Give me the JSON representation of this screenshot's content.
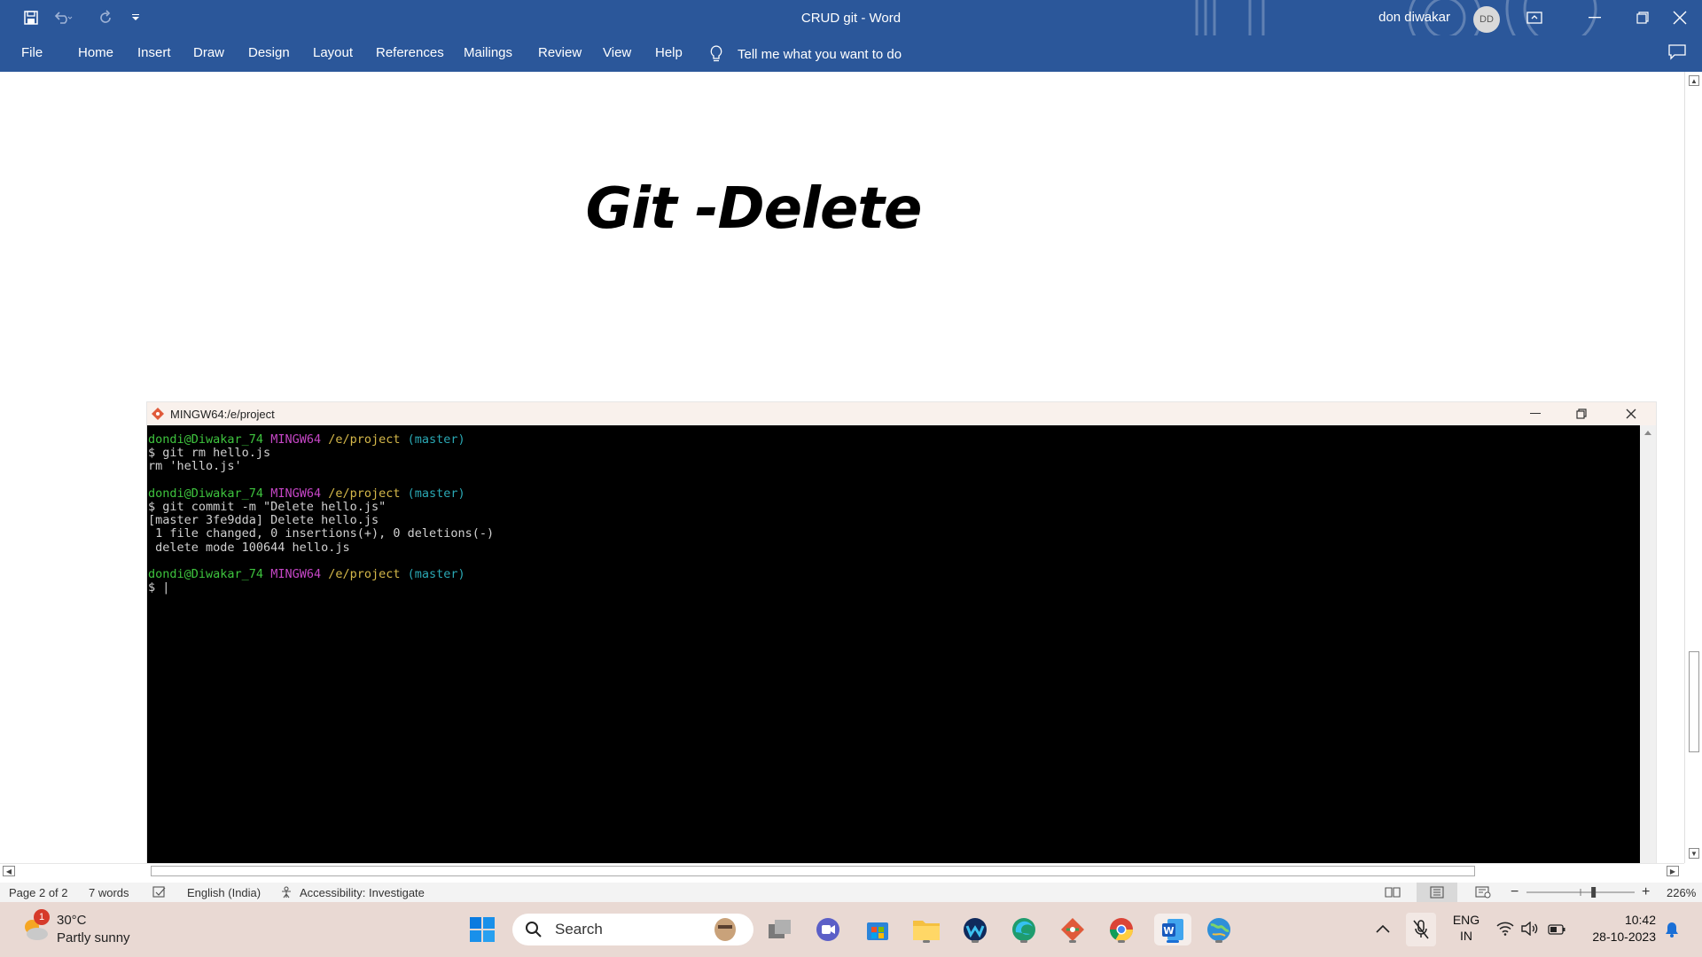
{
  "window": {
    "title": "CRUD git  -  Word",
    "user_name": "don diwakar",
    "user_initials": "DD"
  },
  "ribbon": {
    "tabs": [
      "File",
      "Home",
      "Insert",
      "Draw",
      "Design",
      "Layout",
      "References",
      "Mailings",
      "Review",
      "View",
      "Help"
    ],
    "tell_me": "Tell me what you want to do"
  },
  "document": {
    "heading": "Git -Delete"
  },
  "terminal": {
    "title": "MINGW64:/e/project",
    "prompt_user": "dondi@Diwakar_74",
    "prompt_env": "MINGW64",
    "prompt_path": "/e/project",
    "prompt_branch": "(master)",
    "cmd1": "$ git rm hello.js",
    "out1": "rm 'hello.js'",
    "cmd2": "$ git commit -m \"Delete hello.js\"",
    "out2a": "[master 3fe9dda] Delete hello.js",
    "out2b": " 1 file changed, 0 insertions(+), 0 deletions(-)",
    "out2c": " delete mode 100644 hello.js",
    "cmd3": "$ |"
  },
  "statusbar": {
    "page": "Page 2 of 2",
    "words": "7 words",
    "language": "English (India)",
    "accessibility": "Accessibility: Investigate",
    "zoom": "226%",
    "zoom_level": 0.62
  },
  "taskbar": {
    "weather_temp": "30°C",
    "weather_desc": "Partly sunny",
    "weather_badge": "1",
    "search_label": "Search",
    "lang_line1": "ENG",
    "lang_line2": "IN",
    "time": "10:42",
    "date": "28-10-2023"
  },
  "colors": {
    "word_blue": "#2b579a",
    "taskbar": "#e9d9d3"
  }
}
